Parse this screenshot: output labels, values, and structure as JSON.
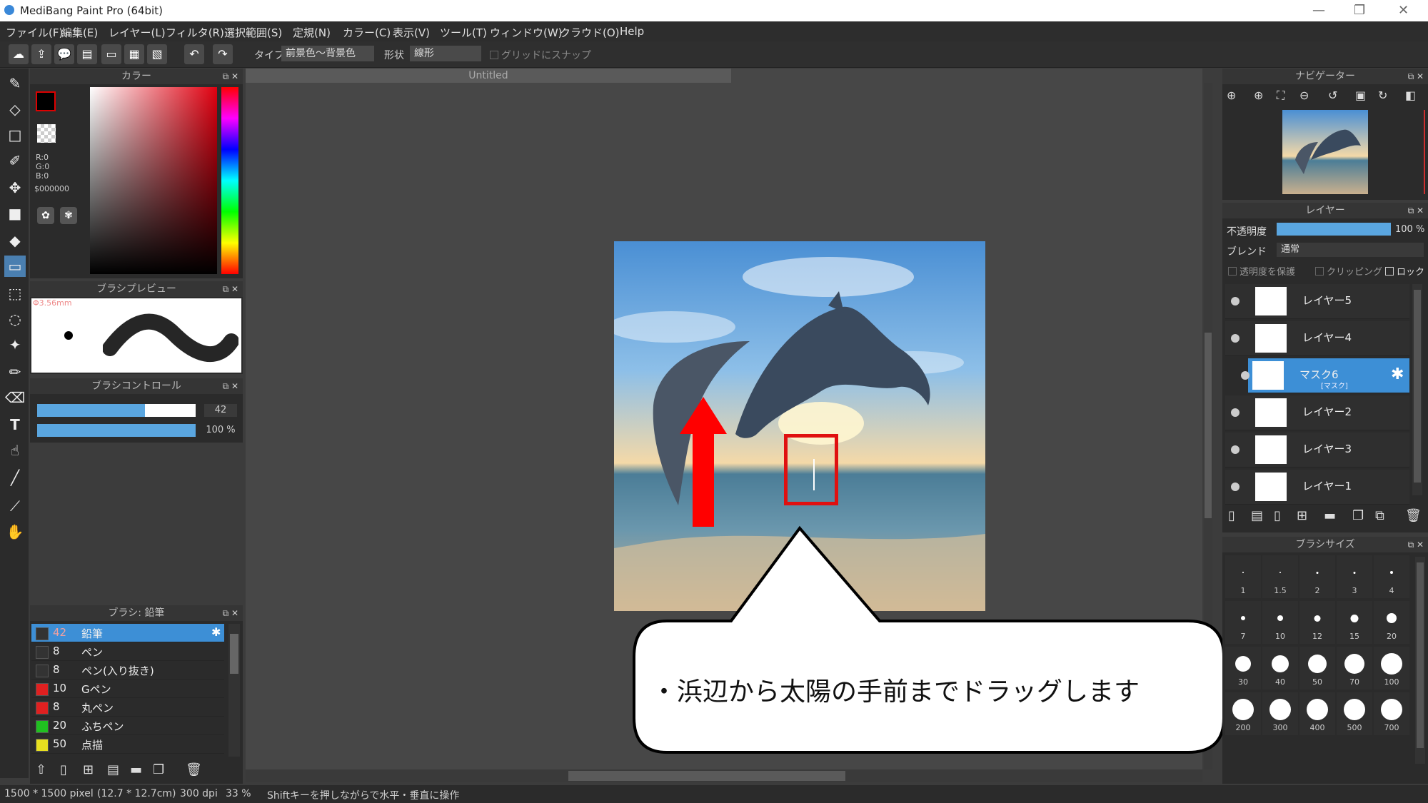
{
  "window": {
    "title": "MediBang Paint Pro (64bit)",
    "minimize": "—",
    "restore": "❐",
    "close": "✕"
  },
  "menu": [
    "ファイル(F)",
    "編集(E)",
    "レイヤー(L)",
    "フィルタ(R)",
    "選択範囲(S)",
    "定規(N)",
    "カラー(C)",
    "表示(V)",
    "ツール(T)",
    "ウィンドウ(W)",
    "クラウド(O)",
    "Help"
  ],
  "toolbar": {
    "type_label": "タイプ",
    "type_value": "前景色～背景色",
    "shape_label": "形状",
    "shape_value": "線形",
    "snap_label": "グリッドにスナップ"
  },
  "color_panel": {
    "title": "カラー",
    "r": "R:0",
    "g": "G:0",
    "b": "B:0",
    "hex": "$000000"
  },
  "brush_preview": {
    "title": "ブラシプレビュー",
    "size": "Φ3.56mm"
  },
  "brush_control": {
    "title": "ブラシコントロール",
    "size_value": "42",
    "opacity_value": "100 %",
    "size_fraction": 0.68,
    "opacity_fraction": 1.0
  },
  "brush_list": {
    "title": "ブラシ: 鉛筆",
    "items": [
      {
        "size": "42",
        "name": "鉛筆",
        "color": "#333333",
        "selected": true
      },
      {
        "size": "8",
        "name": "ペン",
        "color": "#333333"
      },
      {
        "size": "8",
        "name": "ペン(入り抜き)",
        "color": "#333333"
      },
      {
        "size": "10",
        "name": "Gペン",
        "color": "#e02020"
      },
      {
        "size": "8",
        "name": "丸ペン",
        "color": "#e02020"
      },
      {
        "size": "20",
        "name": "ふちペン",
        "color": "#20c020"
      },
      {
        "size": "50",
        "name": "点描",
        "color": "#e8e020"
      }
    ]
  },
  "document": {
    "tab": "Untitled"
  },
  "callout": {
    "text": "・浜辺から太陽の手前までドラッグします"
  },
  "navigator": {
    "title": "ナビゲーター"
  },
  "layers": {
    "title": "レイヤー",
    "opacity_label": "不透明度",
    "opacity_value": "100 %",
    "blend_label": "ブレンド",
    "blend_value": "通常",
    "protect_label": "透明度を保護",
    "clip_label": "クリッピング",
    "lock_label": "ロック",
    "items": [
      {
        "name": "レイヤー5"
      },
      {
        "name": "レイヤー4"
      },
      {
        "name": "マスク6",
        "sub": "[マスク]",
        "selected": true
      },
      {
        "name": "レイヤー2"
      },
      {
        "name": "レイヤー3"
      },
      {
        "name": "レイヤー1"
      }
    ]
  },
  "brush_size": {
    "title": "ブラシサイズ",
    "sizes": [
      "1",
      "1.5",
      "2",
      "3",
      "4",
      "7",
      "10",
      "12",
      "15",
      "20",
      "30",
      "40",
      "50",
      "70",
      "100",
      "200",
      "300",
      "400",
      "500",
      "700"
    ]
  },
  "status": {
    "dims": "1500 * 1500 pixel",
    "physical": "(12.7 * 12.7cm)",
    "dpi": "300 dpi",
    "zoom": "33 %",
    "hint": "Shiftキーを押しながらで水平・垂直に操作"
  },
  "colors": {
    "accent": "#3d8fd6",
    "red_arrow": "#ff0000",
    "highlight_box": "#e01010"
  }
}
